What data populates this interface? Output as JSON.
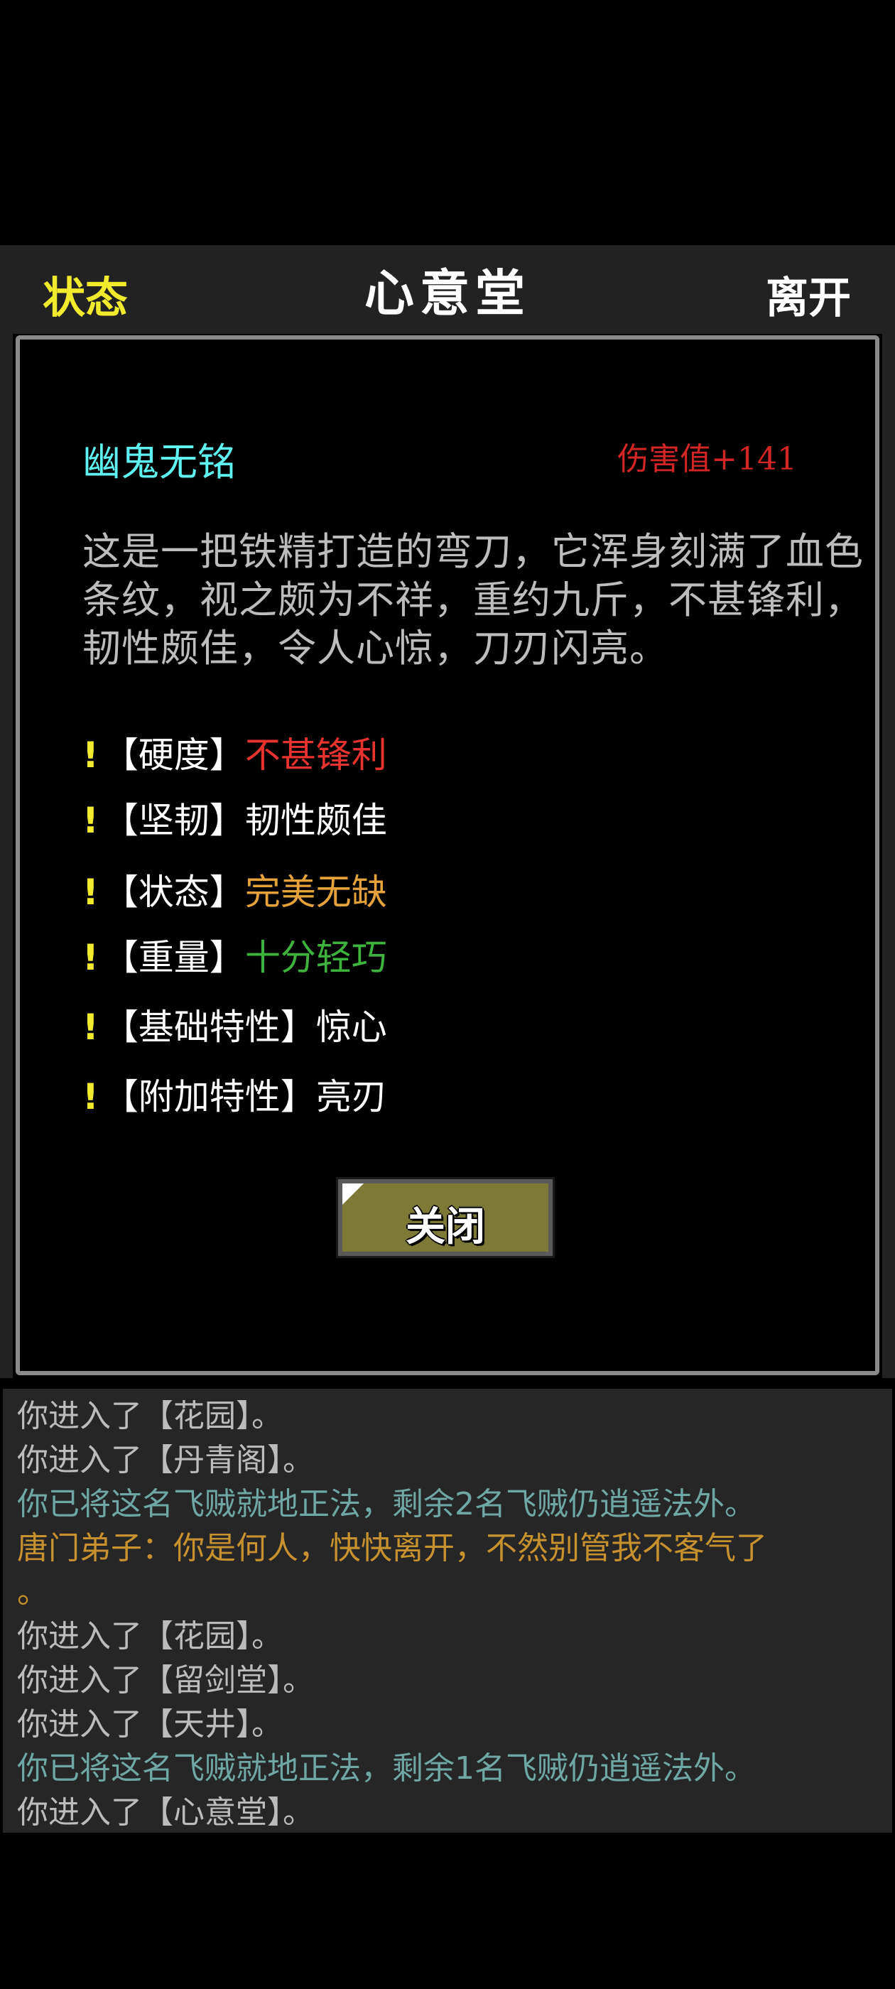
{
  "header": {
    "status_label": "状态",
    "title": "心意堂",
    "leave_label": "离开"
  },
  "item": {
    "name": "幽鬼无铭",
    "damage": "伤害值+141",
    "description": "这是一把铁精打造的弯刀，它浑身刻满了血色条纹，视之颇为不祥，重约九斤，不甚锋利，韧性颇佳，令人心惊，刀刃闪亮。",
    "stats": [
      {
        "mark": "!",
        "label": "【硬度】",
        "value": "不甚锋利",
        "color": "#e8332f"
      },
      {
        "mark": "!",
        "label": "【坚韧】",
        "value": "韧性颇佳",
        "color": "#ffffff"
      },
      {
        "mark": "!",
        "label": "【状态】",
        "value": "完美无缺",
        "color": "#e6a23a"
      },
      {
        "mark": "!",
        "label": "【重量】",
        "value": "十分轻巧",
        "color": "#3db33d"
      },
      {
        "mark": "!",
        "label": "【基础特性】",
        "value": "惊心",
        "color": "#ffffff"
      },
      {
        "mark": "!",
        "label": "【附加特性】",
        "value": "亮刃",
        "color": "#ffffff"
      }
    ],
    "close_label": "关闭"
  },
  "log": [
    {
      "text": "你进入了【花园】。",
      "style": "normal"
    },
    {
      "text": "你进入了【丹青阁】。",
      "style": "normal"
    },
    {
      "text": "你已将这名飞贼就地正法，剩余2名飞贼仍逍遥法外。",
      "style": "teal"
    },
    {
      "text": "唐门弟子：你是何人，快快离开，不然别管我不客气了",
      "style": "orange"
    },
    {
      "text": "。",
      "style": "orange"
    },
    {
      "text": "你进入了【花园】。",
      "style": "normal"
    },
    {
      "text": "你进入了【留剑堂】。",
      "style": "normal"
    },
    {
      "text": "你进入了【天井】。",
      "style": "normal"
    },
    {
      "text": "你已将这名飞贼就地正法，剩余1名飞贼仍逍遥法外。",
      "style": "teal"
    },
    {
      "text": "你进入了【心意堂】。",
      "style": "normal"
    }
  ]
}
